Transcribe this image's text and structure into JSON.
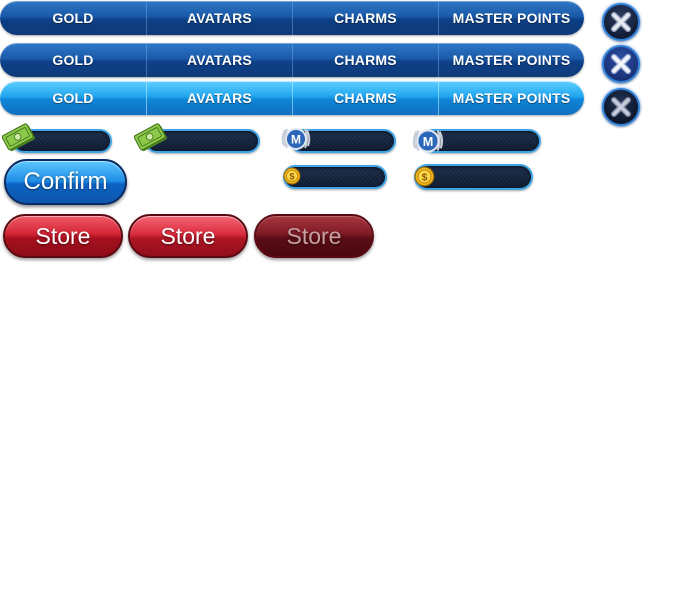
{
  "tab_bars": [
    {
      "state": "normal",
      "tabs": [
        "GOLD",
        "AVATARS",
        "CHARMS",
        "MASTER POINTS"
      ]
    },
    {
      "state": "hover",
      "tabs": [
        "GOLD",
        "AVATARS",
        "CHARMS",
        "MASTER POINTS"
      ]
    },
    {
      "state": "selected",
      "tabs": [
        "GOLD",
        "AVATARS",
        "CHARMS",
        "MASTER POINTS"
      ]
    }
  ],
  "close_buttons": [
    {
      "state": "normal",
      "icon": "close-icon"
    },
    {
      "state": "hover",
      "icon": "close-icon"
    },
    {
      "state": "pressed",
      "icon": "close-icon"
    }
  ],
  "currency_fields": {
    "cash": {
      "icon": "cash-icon",
      "value": ""
    },
    "master_point": {
      "icon": "master-point-icon",
      "value": ""
    },
    "gold_coin": {
      "icon": "gold-coin-icon",
      "value": ""
    }
  },
  "buttons": {
    "confirm_label": "Confirm",
    "store_labels": [
      "Store",
      "Store",
      "Store"
    ]
  },
  "colors": {
    "tab_bar_blue": "#1a5aa8",
    "tab_bar_active": "#22a6ef",
    "store_red": "#d42435",
    "store_disabled": "#7e1a24",
    "field_border": "#3fa4e6",
    "cash_green": "#7dbb3a",
    "coin_gold": "#f2b81c"
  }
}
